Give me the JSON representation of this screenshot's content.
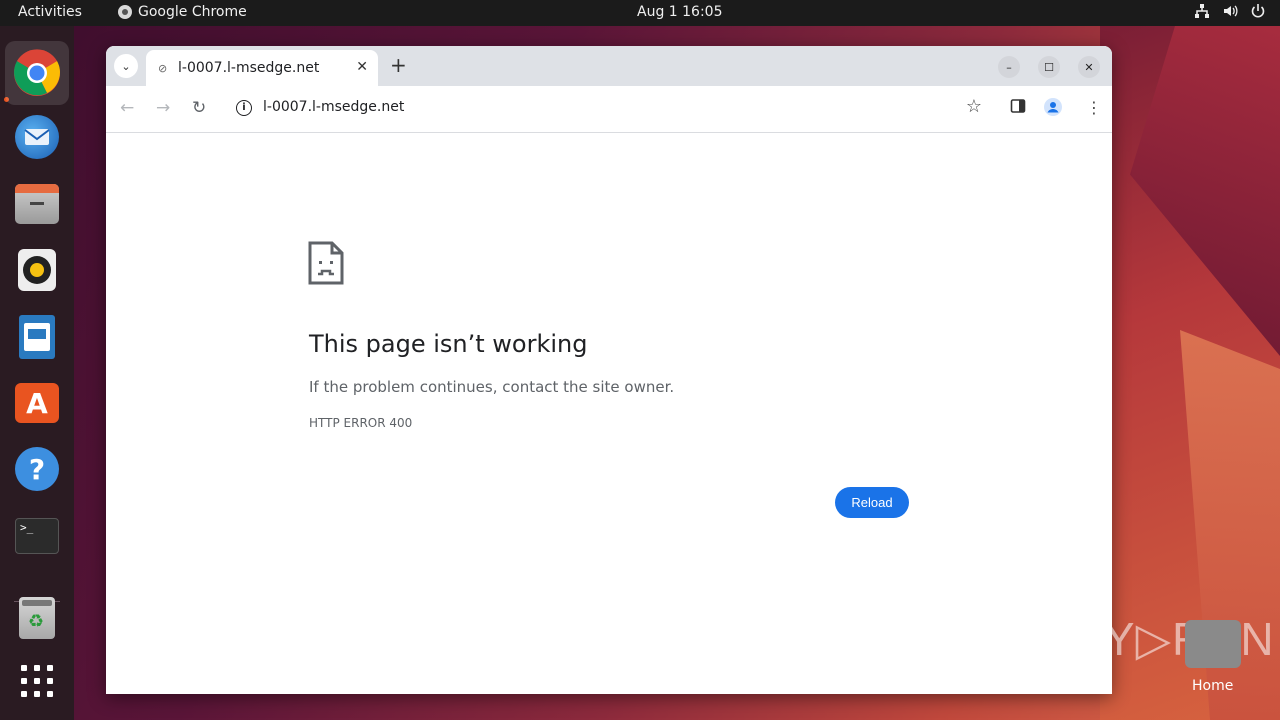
{
  "topbar": {
    "activities": "Activities",
    "app_name": "Google Chrome",
    "clock": "Aug 1  16:05",
    "tray_icons": [
      "network-icon",
      "volume-icon",
      "power-icon"
    ]
  },
  "dock": {
    "items": [
      "chrome",
      "thunderbird",
      "files",
      "rhythmbox",
      "libreoffice-writer",
      "app-center",
      "help",
      "terminal",
      "trash",
      "show-apps"
    ]
  },
  "browser": {
    "tab_title": "l-0007.l-msedge.net",
    "url": "l-0007.l-msedge.net",
    "tab_close": "✕",
    "new_tab": "+"
  },
  "error_page": {
    "title": "This page isn’t working",
    "message": "If the problem continues, contact the site owner.",
    "code": "HTTP ERROR 400",
    "reload_label": "Reload"
  },
  "desktop": {
    "watermark": "ANY▷RUN",
    "home_label": "Home"
  },
  "colors": {
    "accent": "#1a73e8",
    "ubuntu_orange": "#e95420"
  }
}
